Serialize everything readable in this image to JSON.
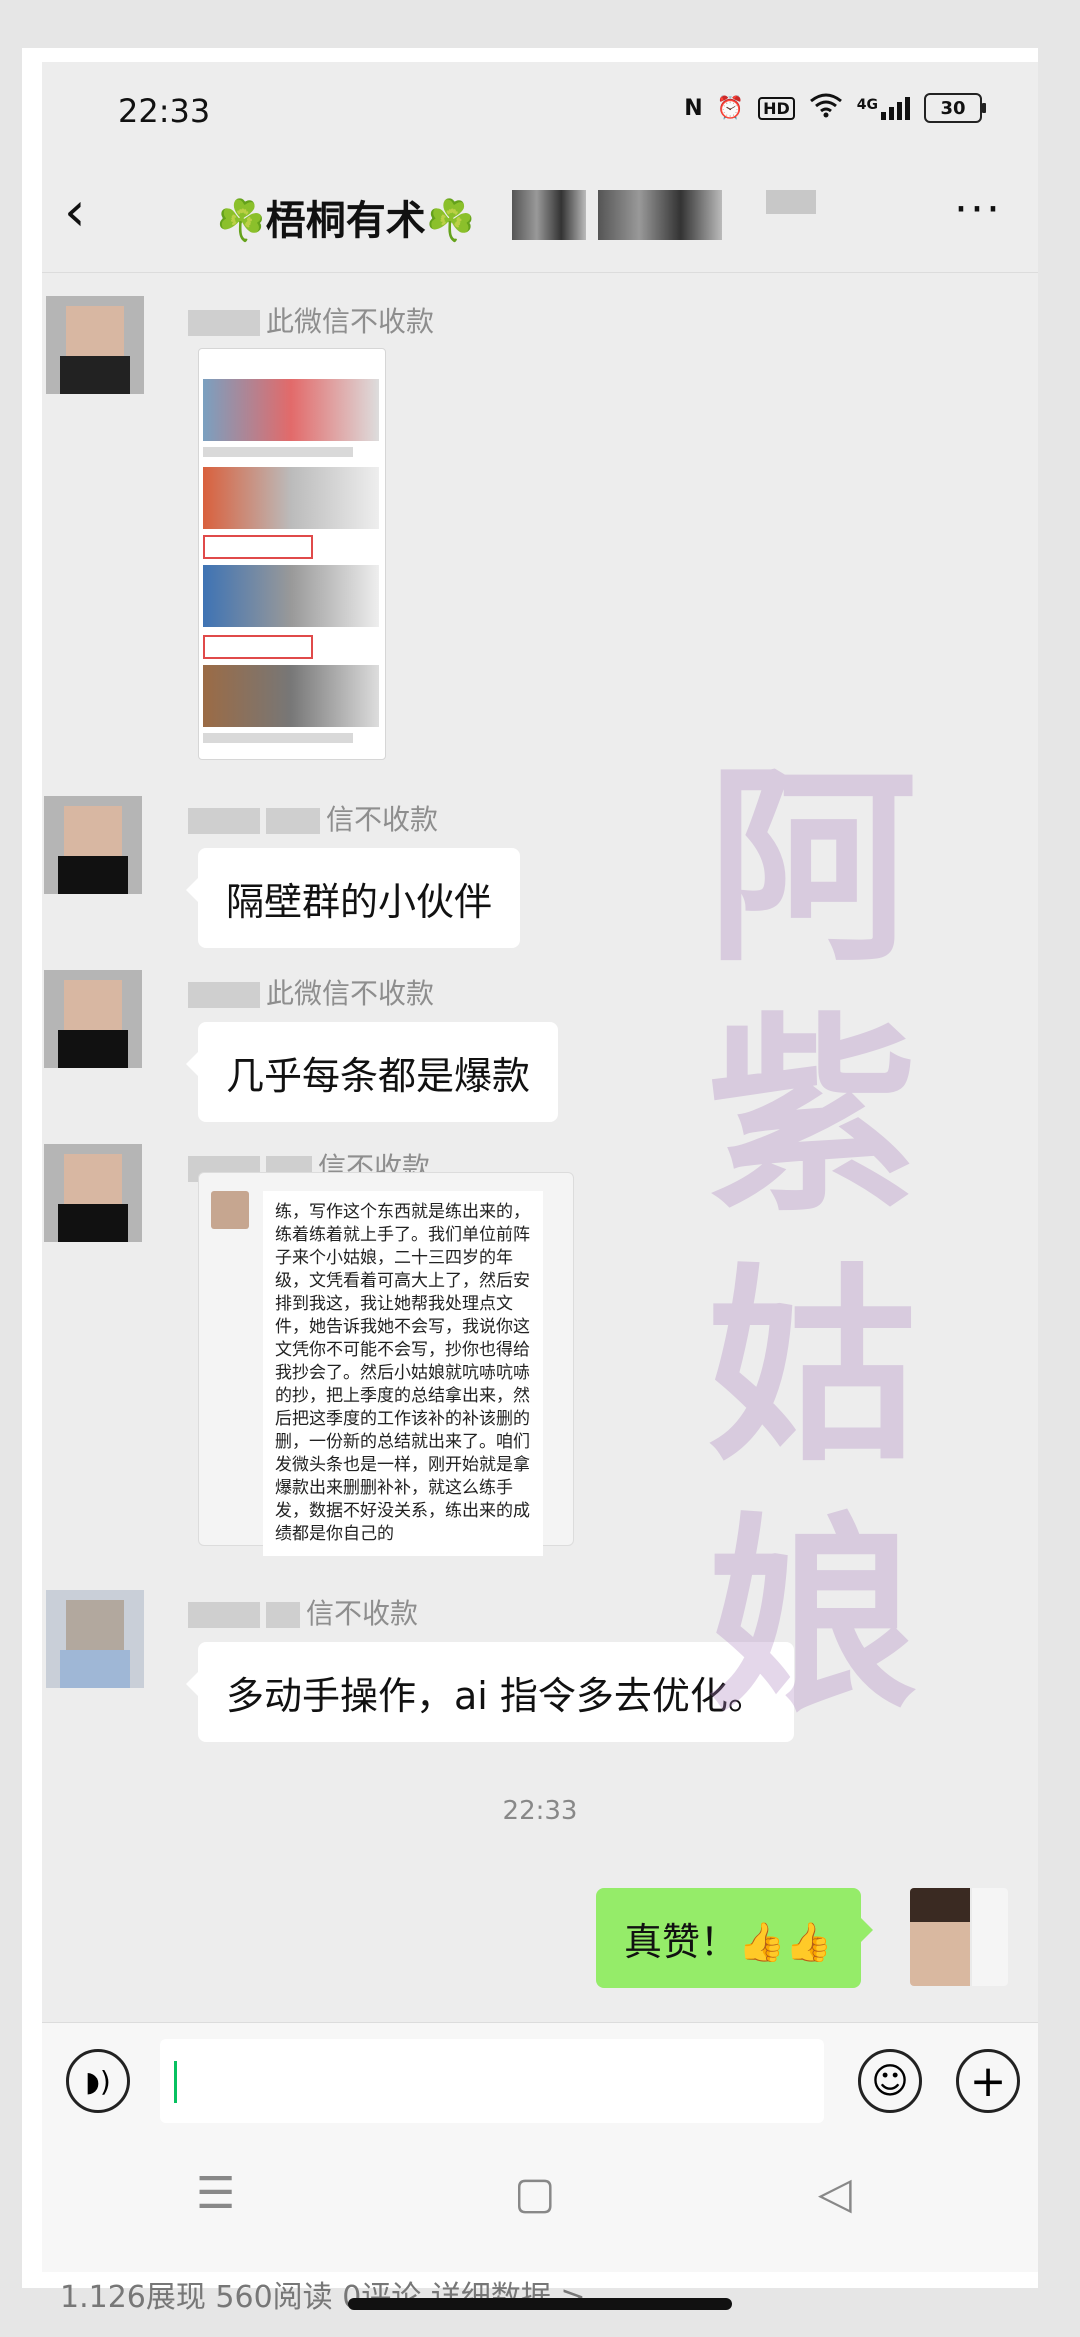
{
  "status_bar": {
    "time": "22:33",
    "nfc_label": "N",
    "hd_label": "HD",
    "signal_label": "4G",
    "battery_level": "30"
  },
  "header": {
    "back_glyph": "‹",
    "title": "☘️梧桐有术☘️",
    "more_glyph": "···"
  },
  "messages": [
    {
      "sender_suffix": "此微信不收款",
      "type": "image"
    },
    {
      "sender_suffix": "信不收款",
      "text": "隔壁群的小伙伴"
    },
    {
      "sender_suffix": "此微信不收款",
      "text": "几乎每条都是爆款"
    },
    {
      "sender_suffix": "信不收款",
      "type": "quote",
      "quote_text": "练，写作这个东西就是练出来的，练着练着就上手了。我们单位前阵子来个小姑娘，二十三四岁的年级，文凭看着可高大上了，然后安排到我这，我让她帮我处理点文件，她告诉我她不会写，我说你这文凭你不可能不会写，抄你也得给我抄会了。然后小姑娘就吭哧吭哧的抄，把上季度的总结拿出来，然后把这季度的工作该补的补该删的删，一份新的总结就出来了。咱们发微头条也是一样，刚开始就是拿爆款出来删删补补，就这么练手发，数据不好没关系，练出来的成绩都是你自己的"
    },
    {
      "sender_suffix": "信不收款",
      "text": "多动手操作，ai 指令多去优化。"
    }
  ],
  "timestamp": "22:33",
  "my_message": {
    "text": "真赞！👍👍"
  },
  "watermark": "阿紫姑娘",
  "input": {
    "placeholder": ""
  },
  "nav": {
    "menu_glyph": "☰",
    "home_glyph": "▢",
    "back_glyph": "◁"
  },
  "behind_text": "1.126展现  560阅读  0评论  详细数据 >"
}
